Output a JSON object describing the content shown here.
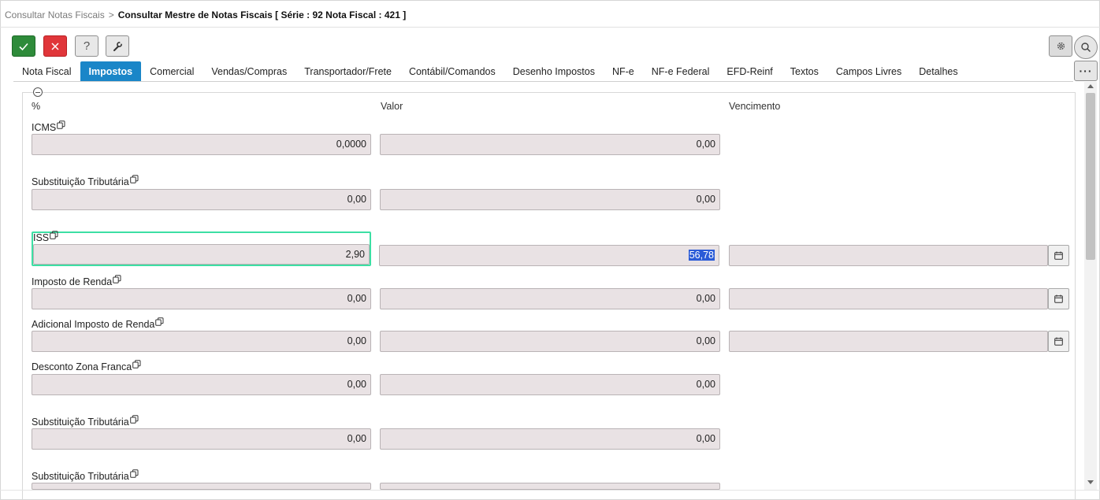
{
  "breadcrumb": {
    "parent": "Consultar Notas Fiscais",
    "separator": ">",
    "current": "Consultar Mestre de Notas Fiscais [ Série : 92 Nota Fiscal : 421 ]"
  },
  "toolbar": {
    "confirm_icon": "check-icon",
    "cancel_icon": "x-icon",
    "help_label": "?",
    "tools_icon": "wrench-icon",
    "settings_icon": "gear-icon",
    "search_icon": "search-icon",
    "more_label": "···"
  },
  "tabs": [
    {
      "label": "Nota Fiscal",
      "active": false
    },
    {
      "label": "Impostos",
      "active": true
    },
    {
      "label": "Comercial",
      "active": false
    },
    {
      "label": "Vendas/Compras",
      "active": false
    },
    {
      "label": "Transportador/Frete",
      "active": false
    },
    {
      "label": "Contábil/Comandos",
      "active": false
    },
    {
      "label": "Desenho Impostos",
      "active": false
    },
    {
      "label": "NF-e",
      "active": false
    },
    {
      "label": "NF-e Federal",
      "active": false
    },
    {
      "label": "EFD-Reinf",
      "active": false
    },
    {
      "label": "Textos",
      "active": false
    },
    {
      "label": "Campos Livres",
      "active": false
    },
    {
      "label": "Detalhes",
      "active": false
    }
  ],
  "columns": {
    "percent": "%",
    "value": "Valor",
    "due": "Vencimento"
  },
  "rows": [
    {
      "label": "ICMS",
      "percent": "0,0000",
      "value": "0,00"
    },
    {
      "label": "Substituição Tributária",
      "percent": "0,00",
      "value": "0,00"
    },
    {
      "label": "ISS",
      "percent": "2,90",
      "value": "56,78",
      "due": ""
    },
    {
      "label": "Imposto de Renda",
      "percent": "0,00",
      "value": "0,00",
      "due": ""
    },
    {
      "label": "Adicional Imposto de Renda",
      "percent": "0,00",
      "value": "0,00",
      "due": ""
    },
    {
      "label": "Desconto Zona Franca",
      "percent": "0,00",
      "value": "0,00"
    },
    {
      "label": "Substituição Tributária",
      "percent": "0,00",
      "value": "0,00"
    },
    {
      "label": "Substituição Tributária",
      "percent": "",
      "value": ""
    }
  ],
  "colors": {
    "accent": "#1a86c8",
    "confirm": "#2e8b3a",
    "cancel": "#e0363a",
    "focus": "#3ddfa4",
    "selection": "#2a5bd7"
  }
}
